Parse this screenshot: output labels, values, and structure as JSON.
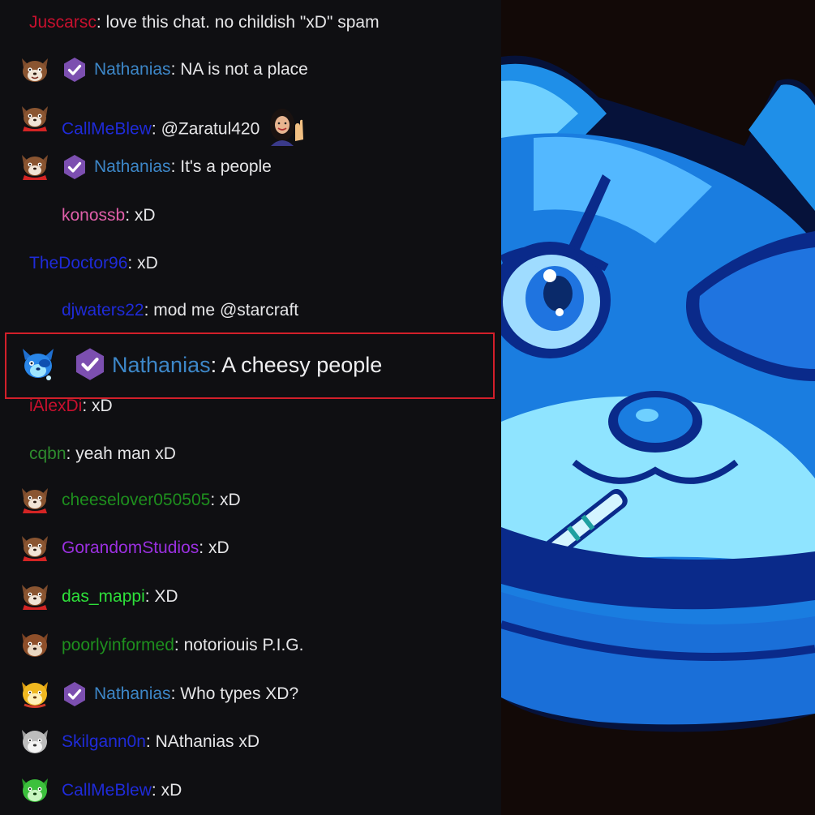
{
  "colors": {
    "chat_bg": "#0f0f12",
    "message_text": "#efeff1",
    "highlight_border": "#d21f2a",
    "badge_purple": "#7c4fb0",
    "stream_bg": "#120907",
    "mascot_blue": "#1a7de0",
    "mascot_light": "#7fe0ff"
  },
  "chat": {
    "messages": [
      {
        "user": "Juscarsc",
        "color": "#c8102e",
        "sep": ":",
        "text": "love this chat. no childish \"xD\" spam",
        "avatar": "none",
        "badge": false
      },
      {
        "user": "Nathanias",
        "color": "#3d87c8",
        "sep": ":",
        "text": "NA is not a place",
        "avatar": "cat-avatar",
        "badge": true
      },
      {
        "user": "CallMeBlew",
        "color": "#1f2bd8",
        "sep": ":",
        "text": "@Zaratul420",
        "avatar": "cat-avatar-red-scarf",
        "badge": false,
        "emote": "waving-woman-emote"
      },
      {
        "user": "Nathanias",
        "color": "#3d87c8",
        "sep": ":",
        "text": "It's a people",
        "avatar": "cat-avatar-red-scarf",
        "badge": true
      },
      {
        "user": "konossb",
        "color": "#e05fa9",
        "sep": ":",
        "text": "xD",
        "avatar": "none",
        "badge": false,
        "indent": true
      },
      {
        "user": "TheDoctor96",
        "color": "#1f2bd8",
        "sep": ":",
        "text": "xD",
        "avatar": "none",
        "badge": false
      },
      {
        "user": "djwaters22",
        "color": "#1f2bd8",
        "sep": ":",
        "text": "mod me @starcraft",
        "avatar": "none",
        "badge": false,
        "indent": true
      },
      {
        "user": "iAlexDi",
        "color": "#c8102e",
        "sep": ":",
        "text": "xD",
        "avatar": "none",
        "badge": false
      },
      {
        "user": "cqbn",
        "color": "#2e8b2e",
        "sep": ":",
        "text": "yeah man xD",
        "avatar": "none",
        "badge": false
      },
      {
        "user": "cheeselover050505",
        "color": "#1e8f1e",
        "sep": ":",
        "text": "xD",
        "avatar": "cat-avatar-red-scarf",
        "badge": false
      },
      {
        "user": "GorandomStudios",
        "color": "#9b30e0",
        "sep": ":",
        "text": "xD",
        "avatar": "cat-avatar-red-scarf",
        "badge": false
      },
      {
        "user": "das_mappi",
        "color": "#2ee03a",
        "sep": ":",
        "text": "XD",
        "avatar": "cat-avatar-red-scarf",
        "badge": false
      },
      {
        "user": "poorlyinformed",
        "color": "#1e8f1e",
        "sep": ":",
        "text": "notoriouis P.I.G.",
        "avatar": "cat-avatar-brown",
        "badge": false
      },
      {
        "user": "Nathanias",
        "color": "#3d87c8",
        "sep": ":",
        "text": "Who types XD?",
        "avatar": "cat-avatar-gold",
        "badge": true
      },
      {
        "user": "Skilgann0n",
        "color": "#1f2bd8",
        "sep": ":",
        "text": "NAthanias xD",
        "avatar": "cat-avatar-gray",
        "badge": false
      },
      {
        "user": "CallMeBlew",
        "color": "#1f2bd8",
        "sep": ":",
        "text": "xD",
        "avatar": "cat-avatar-green",
        "badge": false
      }
    ],
    "highlighted": {
      "user": "Nathanias",
      "color": "#3d87c8",
      "sep": ":",
      "text": "A cheesy people",
      "avatar": "cat-avatar-blue",
      "badge": true
    }
  },
  "stream": {
    "mascot": "blue-raccoon-mascot"
  }
}
